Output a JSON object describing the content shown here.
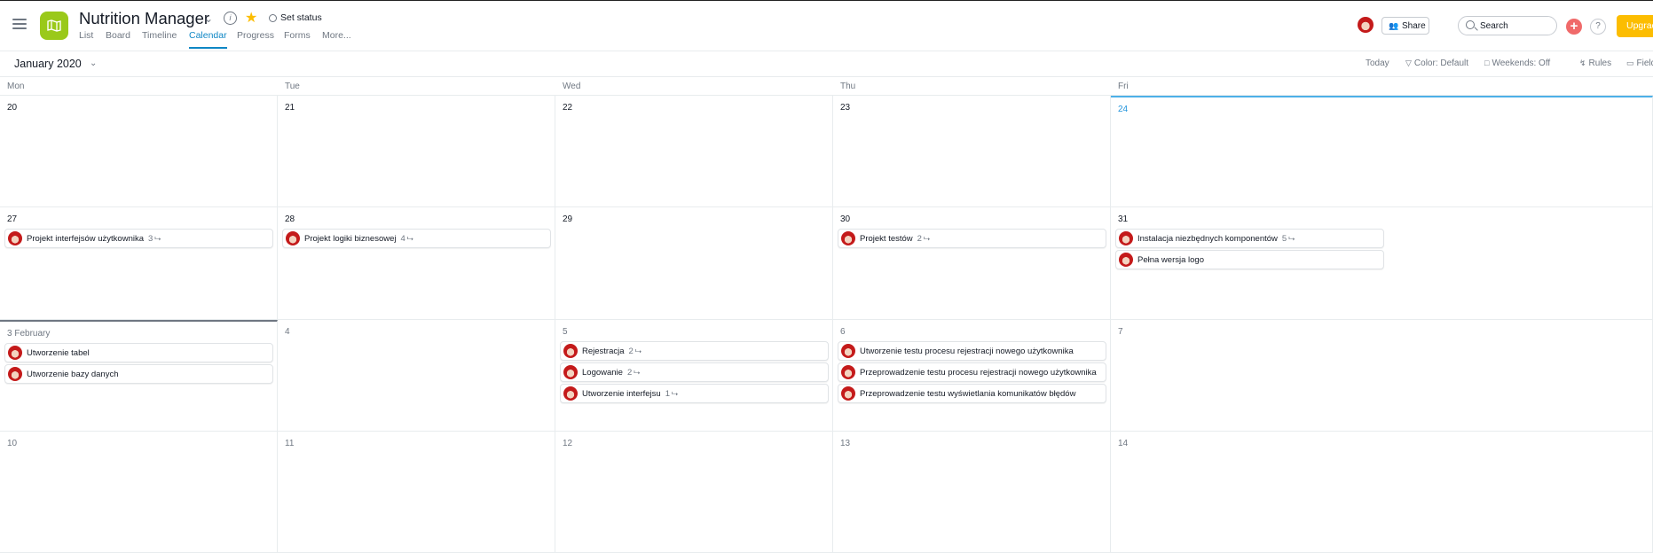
{
  "header": {
    "project_title": "Nutrition Manager",
    "set_status": "Set status",
    "tabs": [
      "List",
      "Board",
      "Timeline",
      "Calendar",
      "Progress",
      "Forms",
      "More..."
    ],
    "active_tab": "Calendar",
    "share_label": "Share",
    "search_placeholder": "Search",
    "upgrade_label": "Upgrade"
  },
  "toolbar": {
    "month": "January 2020",
    "today": "Today",
    "color": "Color: Default",
    "weekends": "Weekends: Off",
    "rules": "Rules",
    "fields": "Fields"
  },
  "calendar": {
    "day_headers": [
      "Mon",
      "Tue",
      "Wed",
      "Thu",
      "Fri"
    ],
    "weeks": [
      {
        "days": [
          {
            "label": "20",
            "tasks": []
          },
          {
            "label": "21",
            "tasks": []
          },
          {
            "label": "22",
            "tasks": []
          },
          {
            "label": "23",
            "tasks": []
          },
          {
            "label": "24",
            "tasks": []
          }
        ]
      },
      {
        "days": [
          {
            "label": "27",
            "tasks": [
              {
                "name": "Projekt interfejsów użytkownika",
                "subtasks": "3"
              }
            ]
          },
          {
            "label": "28",
            "tasks": [
              {
                "name": "Projekt logiki biznesowej",
                "subtasks": "4"
              }
            ]
          },
          {
            "label": "29",
            "tasks": []
          },
          {
            "label": "30",
            "tasks": [
              {
                "name": "Projekt testów",
                "subtasks": "2"
              }
            ]
          },
          {
            "label": "31",
            "tasks": [
              {
                "name": "Instalacja niezbędnych komponentów",
                "subtasks": "5"
              },
              {
                "name": "Pełna wersja logo",
                "subtasks": ""
              }
            ]
          }
        ]
      },
      {
        "days": [
          {
            "label": "3 February",
            "tasks": [
              {
                "name": "Utworzenie tabel",
                "subtasks": ""
              },
              {
                "name": "Utworzenie bazy danych",
                "subtasks": ""
              }
            ]
          },
          {
            "label": "4",
            "tasks": []
          },
          {
            "label": "5",
            "tasks": [
              {
                "name": "Rejestracja",
                "subtasks": "2"
              },
              {
                "name": "Logowanie",
                "subtasks": "2"
              },
              {
                "name": "Utworzenie interfejsu",
                "subtasks": "1"
              }
            ]
          },
          {
            "label": "6",
            "tasks": [
              {
                "name": "Utworzenie testu procesu rejestracji nowego użytkownika",
                "subtasks": ""
              },
              {
                "name": "Przeprowadzenie testu procesu rejestracji nowego użytkownika",
                "subtasks": ""
              },
              {
                "name": "Przeprowadzenie testu wyświetlania komunikatów błędów",
                "subtasks": ""
              }
            ]
          },
          {
            "label": "7",
            "tasks": []
          }
        ]
      },
      {
        "days": [
          {
            "label": "10",
            "tasks": []
          },
          {
            "label": "11",
            "tasks": []
          },
          {
            "label": "12",
            "tasks": []
          },
          {
            "label": "13",
            "tasks": []
          },
          {
            "label": "14",
            "tasks": []
          }
        ]
      }
    ]
  },
  "colors": {
    "accent": "#0f87c5",
    "today_border": "#4db0e8",
    "project_icon": "#9ac91a",
    "add_button": "#f06a6a",
    "upgrade": "#fcbd01",
    "star": "#fcbd01"
  },
  "icons": {
    "menu": "hamburger-icon",
    "project": "map-icon",
    "info": "info-icon",
    "favorite": "star-icon",
    "status": "circle-icon",
    "search": "search-icon",
    "add": "plus-icon",
    "help": "question-icon",
    "subtask": "subtask-icon"
  }
}
